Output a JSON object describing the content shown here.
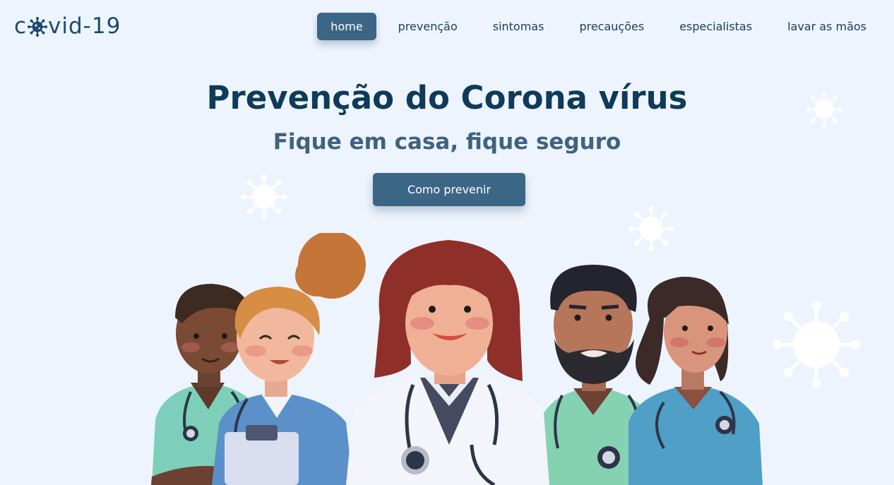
{
  "logo": {
    "prefix": "c",
    "suffix": "vid-19",
    "icon": "virus-icon"
  },
  "nav": {
    "items": [
      {
        "label": "home",
        "active": true
      },
      {
        "label": "prevenção",
        "active": false
      },
      {
        "label": "sintomas",
        "active": false
      },
      {
        "label": "precauções",
        "active": false
      },
      {
        "label": "especialistas",
        "active": false
      },
      {
        "label": "lavar as mãos",
        "active": false
      }
    ]
  },
  "hero": {
    "title": "Prevenção do Corona vírus",
    "subtitle": "Fique em casa, fique seguro",
    "cta_label": "Como prevenir",
    "illustration": "healthcare-workers-illustration"
  },
  "colors": {
    "background": "#edf4fd",
    "primary": "#3c6685",
    "heading": "#0f3a5a",
    "subheading": "#3f6281"
  }
}
